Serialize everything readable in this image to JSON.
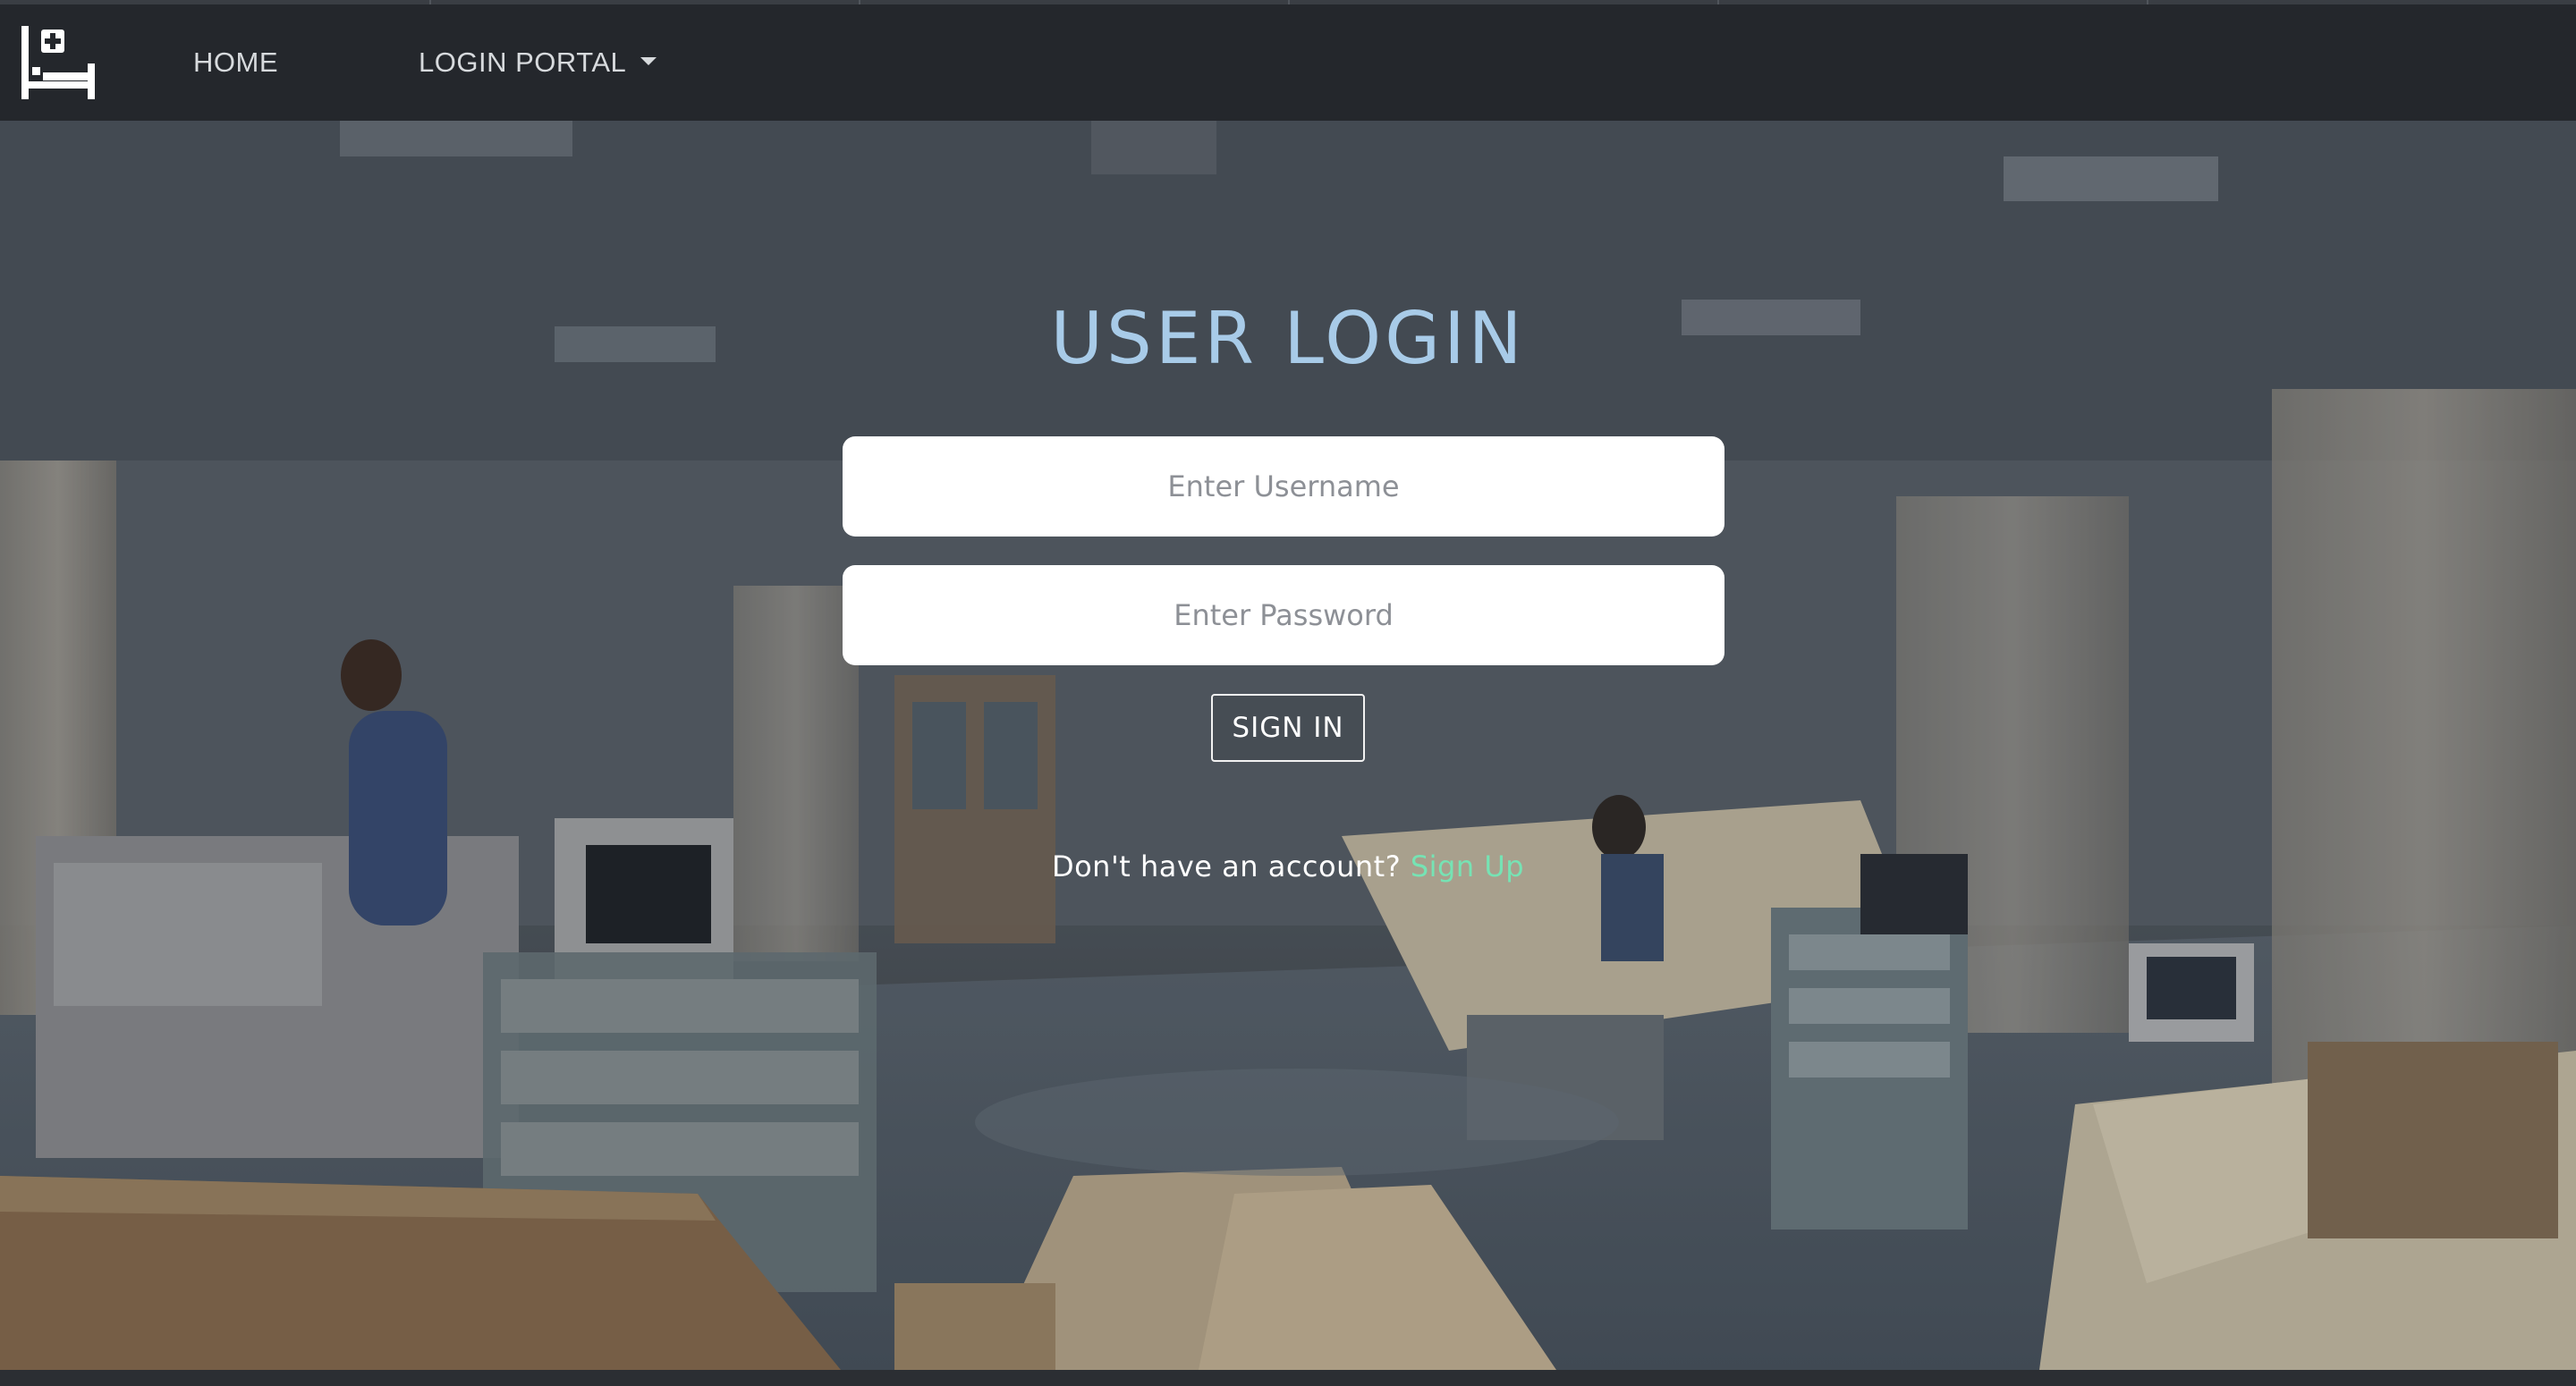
{
  "navbar": {
    "logo_icon": "hospital-bed-icon",
    "home_label": "HOME",
    "portal_label": "LOGIN PORTAL",
    "portal_icon": "caret-down-icon"
  },
  "login": {
    "title": "USER LOGIN",
    "username_placeholder": "Enter Username",
    "password_placeholder": "Enter Password",
    "signin_label": "SIGN IN",
    "signup_prompt": "Don't have an account?",
    "signup_link": "Sign Up"
  },
  "colors": {
    "navbar_bg": "#24272c",
    "title": "#a8cbe8",
    "signup_link": "#76e3b4"
  }
}
